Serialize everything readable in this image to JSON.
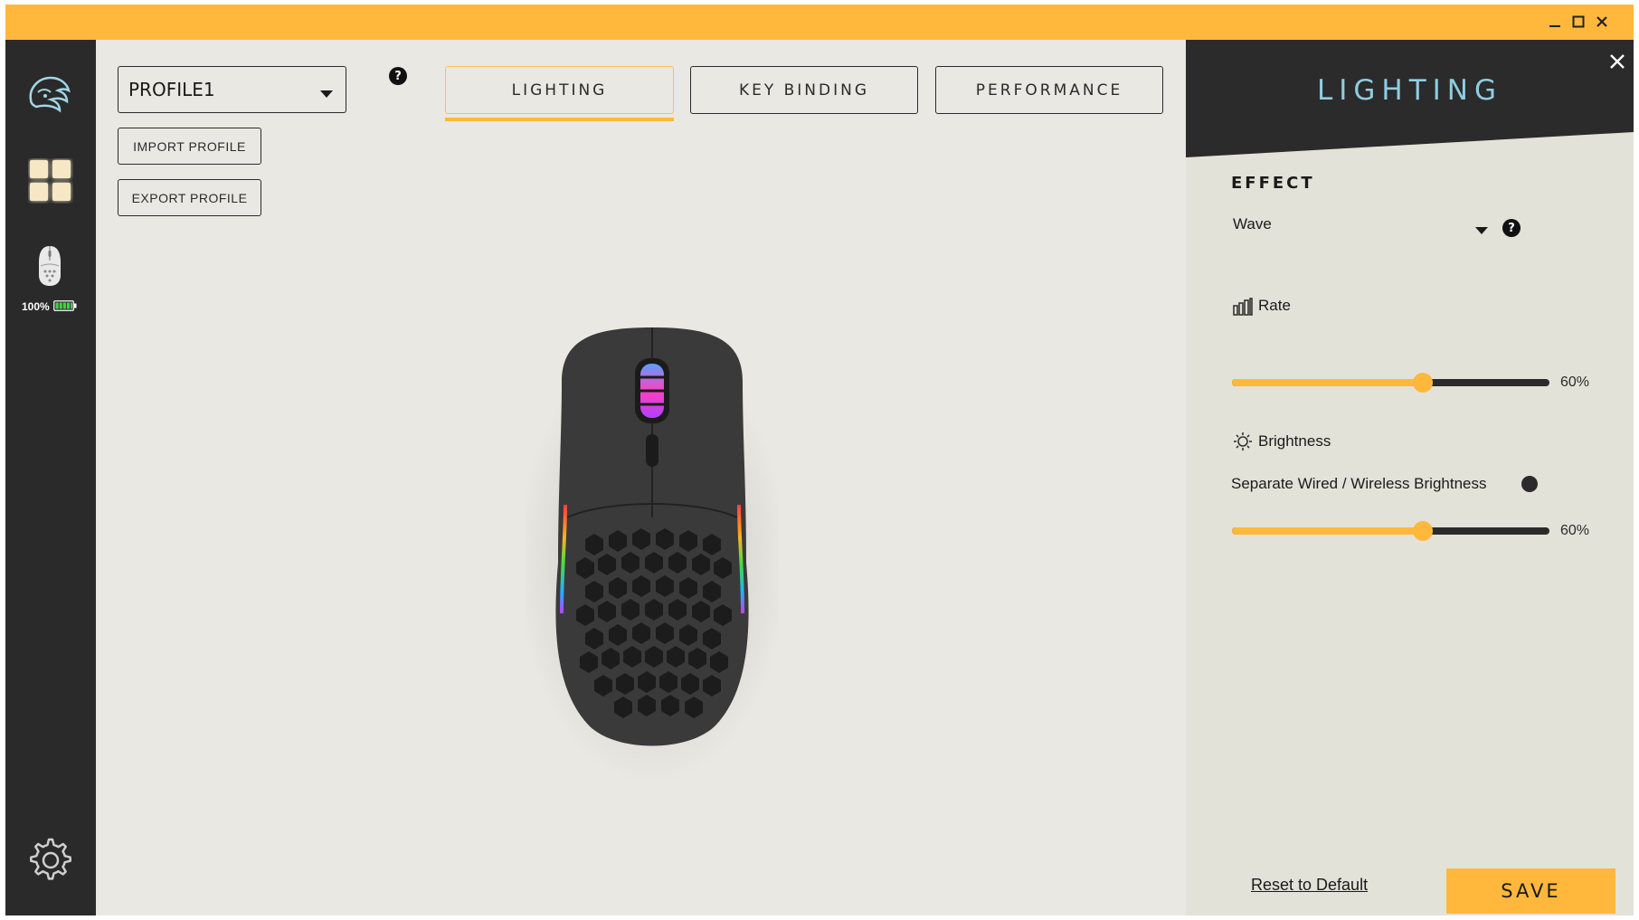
{
  "window": {
    "controls": {
      "minimize": "minimize-icon",
      "maximize": "maximize-icon",
      "close": "close-icon"
    }
  },
  "sidebar": {
    "battery_text": "100%",
    "battery_level": 1.0
  },
  "profile": {
    "selected": "PROFILE1",
    "import_label": "IMPORT PROFILE",
    "export_label": "EXPORT PROFILE",
    "help": "?"
  },
  "tabs": [
    {
      "label": "LIGHTING",
      "active": true
    },
    {
      "label": "KEY BINDING",
      "active": false
    },
    {
      "label": "PERFORMANCE",
      "active": false
    }
  ],
  "panel": {
    "title": "LIGHTING",
    "effect_heading": "EFFECT",
    "effect_value": "Wave",
    "help": "?",
    "rate_label": "Rate",
    "rate_value": 0.6,
    "rate_text": "60%",
    "brightness_label": "Brightness",
    "separate_label": "Separate Wired / Wireless Brightness",
    "brightness_value": 0.6,
    "brightness_text": "60%",
    "reset_label": "Reset to Default",
    "save_label": "SAVE"
  },
  "colors": {
    "accent": "#ffb83b",
    "dark": "#2b2b2b",
    "title_blue": "#8fcde0"
  }
}
